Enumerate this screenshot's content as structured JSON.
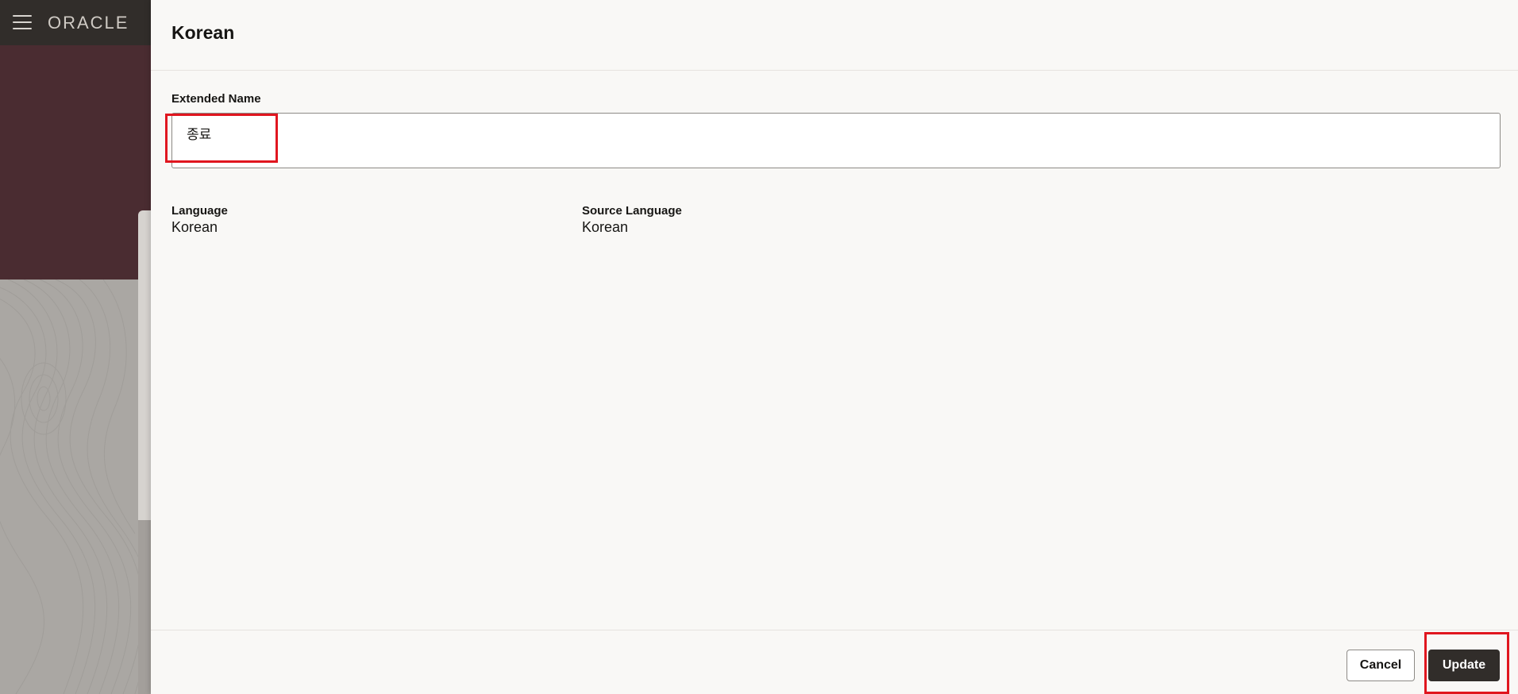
{
  "app": {
    "logo_text": "ORACLE",
    "menu_icon": "hamburger-menu-icon"
  },
  "drawer": {
    "title": "Korean",
    "extended_name": {
      "label": "Extended Name",
      "value": "종료"
    },
    "language": {
      "label": "Language",
      "value": "Korean"
    },
    "source_language": {
      "label": "Source Language",
      "value": "Korean"
    }
  },
  "footer": {
    "cancel_label": "Cancel",
    "update_label": "Update"
  },
  "colors": {
    "topbar": "#312d2a",
    "banner": "#4a2c31",
    "drawer_bg": "#f9f8f6",
    "primary_button": "#312d2a",
    "highlight": "#e0161f"
  }
}
